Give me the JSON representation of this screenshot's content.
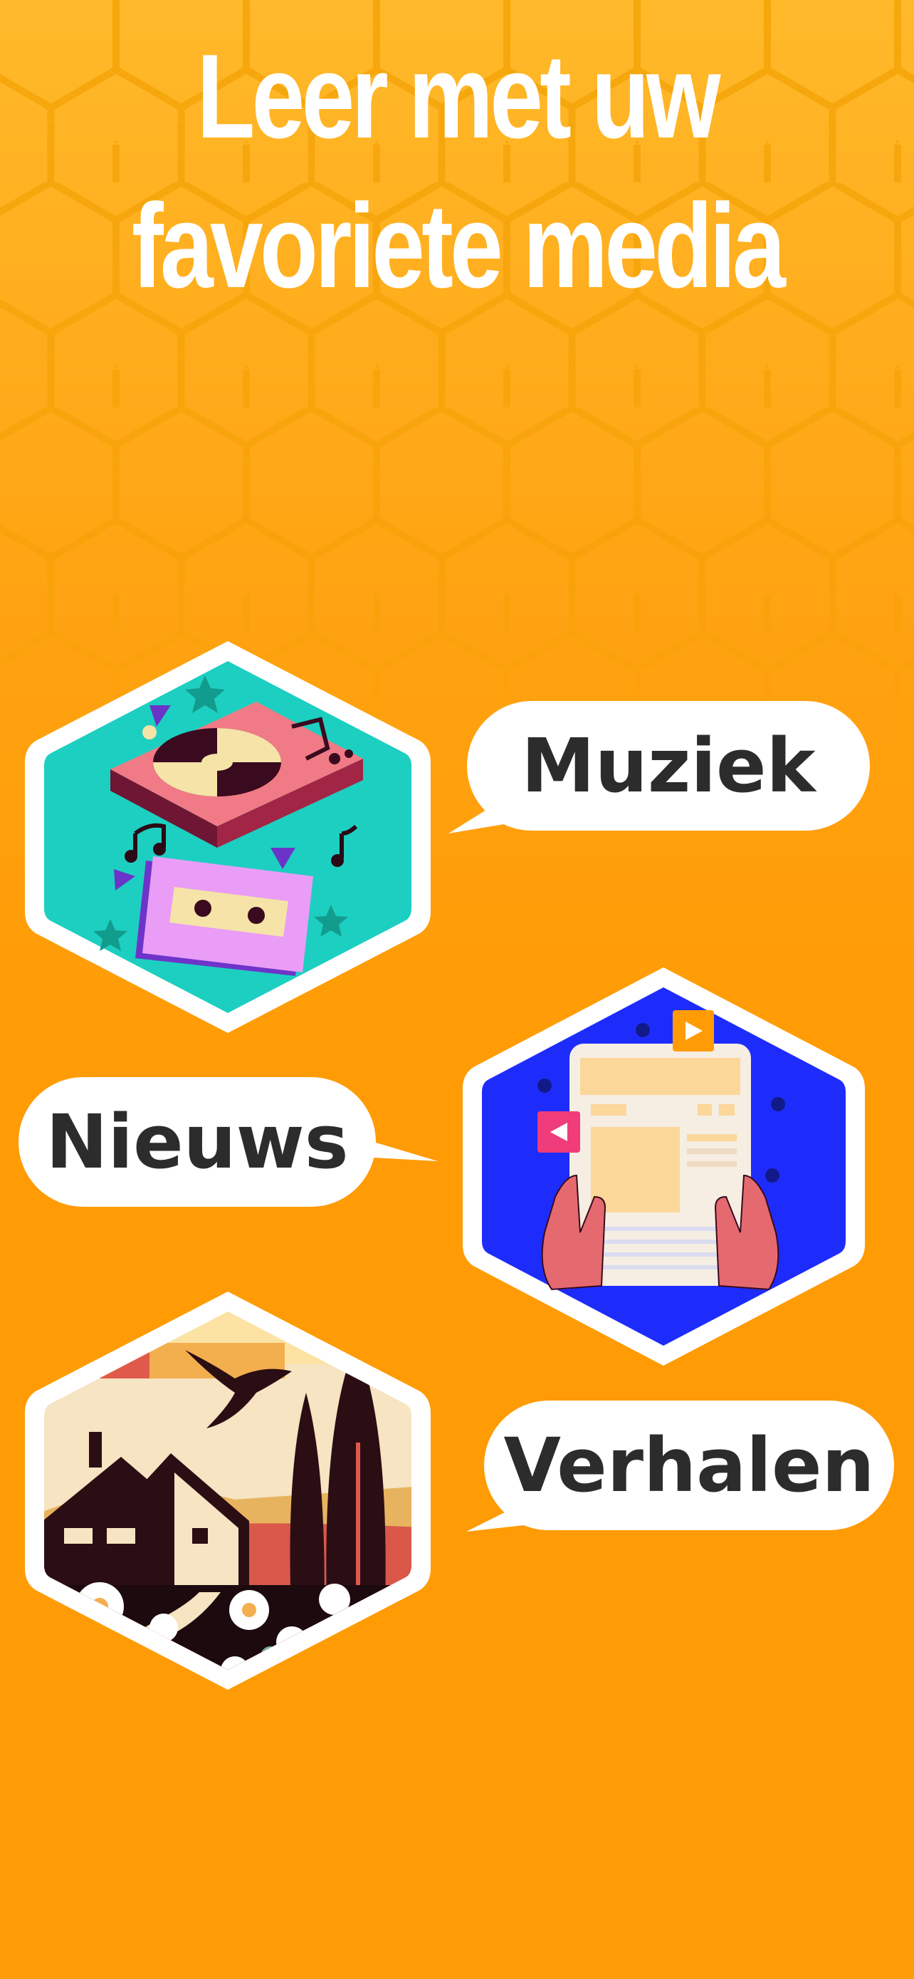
{
  "title": {
    "line1": "Leer met uw",
    "line2": "favoriete media"
  },
  "categories": [
    {
      "label": "Muziek",
      "illustration": "turntable-cassette-illustration",
      "bg": "#1DCFC0"
    },
    {
      "label": "Nieuws",
      "illustration": "newspaper-tablet-illustration",
      "bg": "#1E2CFB"
    },
    {
      "label": "Verhalen",
      "illustration": "house-landscape-illustration",
      "bg": "#F6E4C2"
    }
  ],
  "colors": {
    "background": "#FF9B04",
    "pattern": "#F5A000",
    "bubble": "#FFFFFF",
    "text_dark": "#2C2C2C"
  }
}
